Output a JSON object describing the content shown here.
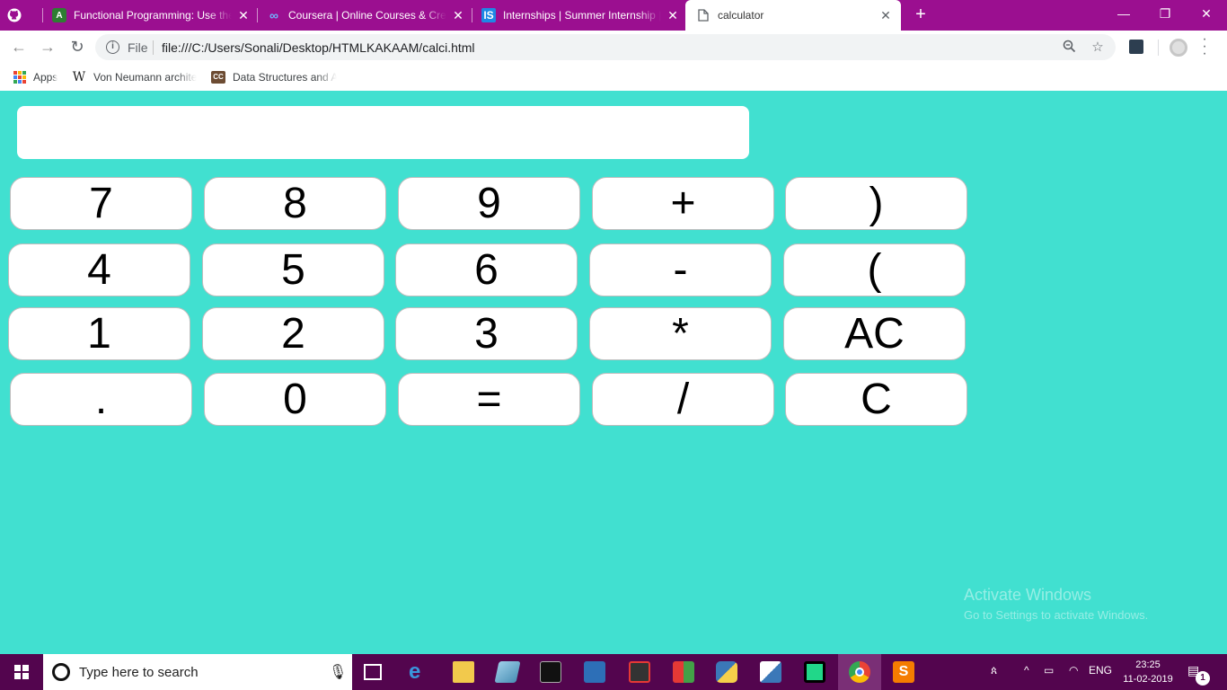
{
  "browser": {
    "tabs": [
      {
        "title": "",
        "icon": "github-icon",
        "active": false
      },
      {
        "title": "Functional Programming: Use the",
        "icon": "android-dev-icon",
        "active": false
      },
      {
        "title": "Coursera | Online Courses & Cred",
        "icon": "coursera-icon",
        "active": false
      },
      {
        "title": "Internships | Summer Internship |",
        "icon": "internshala-icon",
        "active": false
      },
      {
        "title": "calculator",
        "icon": "page-icon",
        "active": true
      }
    ],
    "tab_close_glyph": "✕",
    "new_tab_glyph": "+",
    "window_controls": {
      "minimize": "—",
      "restore": "❐",
      "close": "✕"
    },
    "nav": {
      "back": "←",
      "forward": "→",
      "reload": "↻"
    },
    "address": {
      "scheme_label": "File",
      "url": "file:///C:/Users/Sonali/Desktop/HTMLKAKAAM/calci.html"
    },
    "bookmarks": [
      {
        "label": "Apps",
        "icon": "apps-grid-icon"
      },
      {
        "label": "Von Neumann archite",
        "icon": "wikipedia-icon"
      },
      {
        "label": "Data Structures and A",
        "icon": "codechef-icon"
      }
    ]
  },
  "calculator": {
    "display_value": "",
    "keys": [
      [
        "7",
        "8",
        "9",
        "+",
        ")"
      ],
      [
        "4",
        "5",
        "6",
        "-",
        "("
      ],
      [
        "1",
        "2",
        "3",
        "*",
        "AC"
      ],
      [
        ".",
        "0",
        "=",
        "/",
        "C"
      ]
    ],
    "background_color": "#41e0d0"
  },
  "watermark": {
    "title": "Activate Windows",
    "subtitle": "Go to Settings to activate Windows."
  },
  "taskbar": {
    "search_placeholder": "Type here to search",
    "language": "ENG",
    "time": "23:25",
    "date": "11-02-2019",
    "notification_count": "1",
    "accent_color": "#53054e"
  },
  "colors": {
    "tabstrip": "#9b0f90",
    "page_background": "#41e0d0"
  }
}
